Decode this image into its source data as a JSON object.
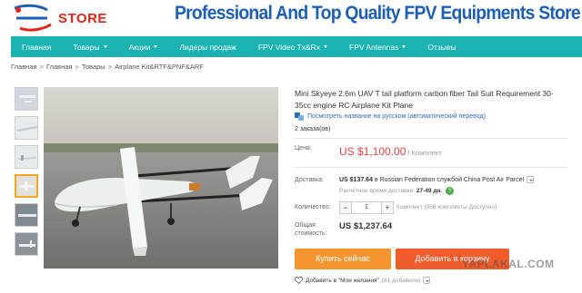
{
  "header": {
    "logo_text": "STORE",
    "banner_title": "Professional And Top Quality FPV Equipments Store",
    "colors": {
      "banner_title": "#1c5fb5",
      "logo_accent": "#e1251b"
    }
  },
  "nav": {
    "items": [
      {
        "label": "Главная",
        "has_dropdown": false
      },
      {
        "label": "Товары",
        "has_dropdown": true
      },
      {
        "label": "Акции",
        "has_dropdown": true
      },
      {
        "label": "Лидеры продаж",
        "has_dropdown": false
      },
      {
        "label": "FPV Video Tx&Rx",
        "has_dropdown": true
      },
      {
        "label": "FPV Antennas",
        "has_dropdown": true
      },
      {
        "label": "Отзывы",
        "has_dropdown": false
      }
    ],
    "color": "#1bb2b2"
  },
  "breadcrumb": [
    "Главная",
    "Главная",
    "Товары",
    "Airplane Kit&RTF&PNF&ARF"
  ],
  "gallery": {
    "thumb_count": 6,
    "active_index": 3,
    "main_alt_icon": "uav-airplane-photo"
  },
  "product": {
    "title": "Mini Skyeye 2.6m UAV T tail platform carbon fiber Tail Suit Requirement 30-35cc engine RC Airplane Kit Plane",
    "translate_link": "Посмотреть название на русском (автоматический перевод)",
    "orders": "2 заказа(ов)"
  },
  "pricing": {
    "price_label": "Цена:",
    "price": "US $1,100.00",
    "price_unit": "/ Комплект",
    "shipping_label": "Доставка:",
    "shipping_cost": "US $137.64",
    "shipping_desc": "в Russian Federation службой China Post Air Parcel",
    "delivery_label": "Расчётное время доставки:",
    "delivery_time": "27-49 дн.",
    "qty_label": "Количество:",
    "qty_value": "1",
    "qty_minus": "−",
    "qty_plus": "+",
    "qty_note": "Комплект (998 комплекты Доступно)",
    "total_label_1": "Общая",
    "total_label_2": "стоимость:",
    "total": "US $1,237.64"
  },
  "actions": {
    "buy_now": "Купить сейчас",
    "add_to_cart": "Добавить в корзину",
    "wishlist": "Добавить в \"Мои желания\"",
    "wishlist_count": "(81 добавили)"
  },
  "watermark": "YAPLAKAL.COM"
}
